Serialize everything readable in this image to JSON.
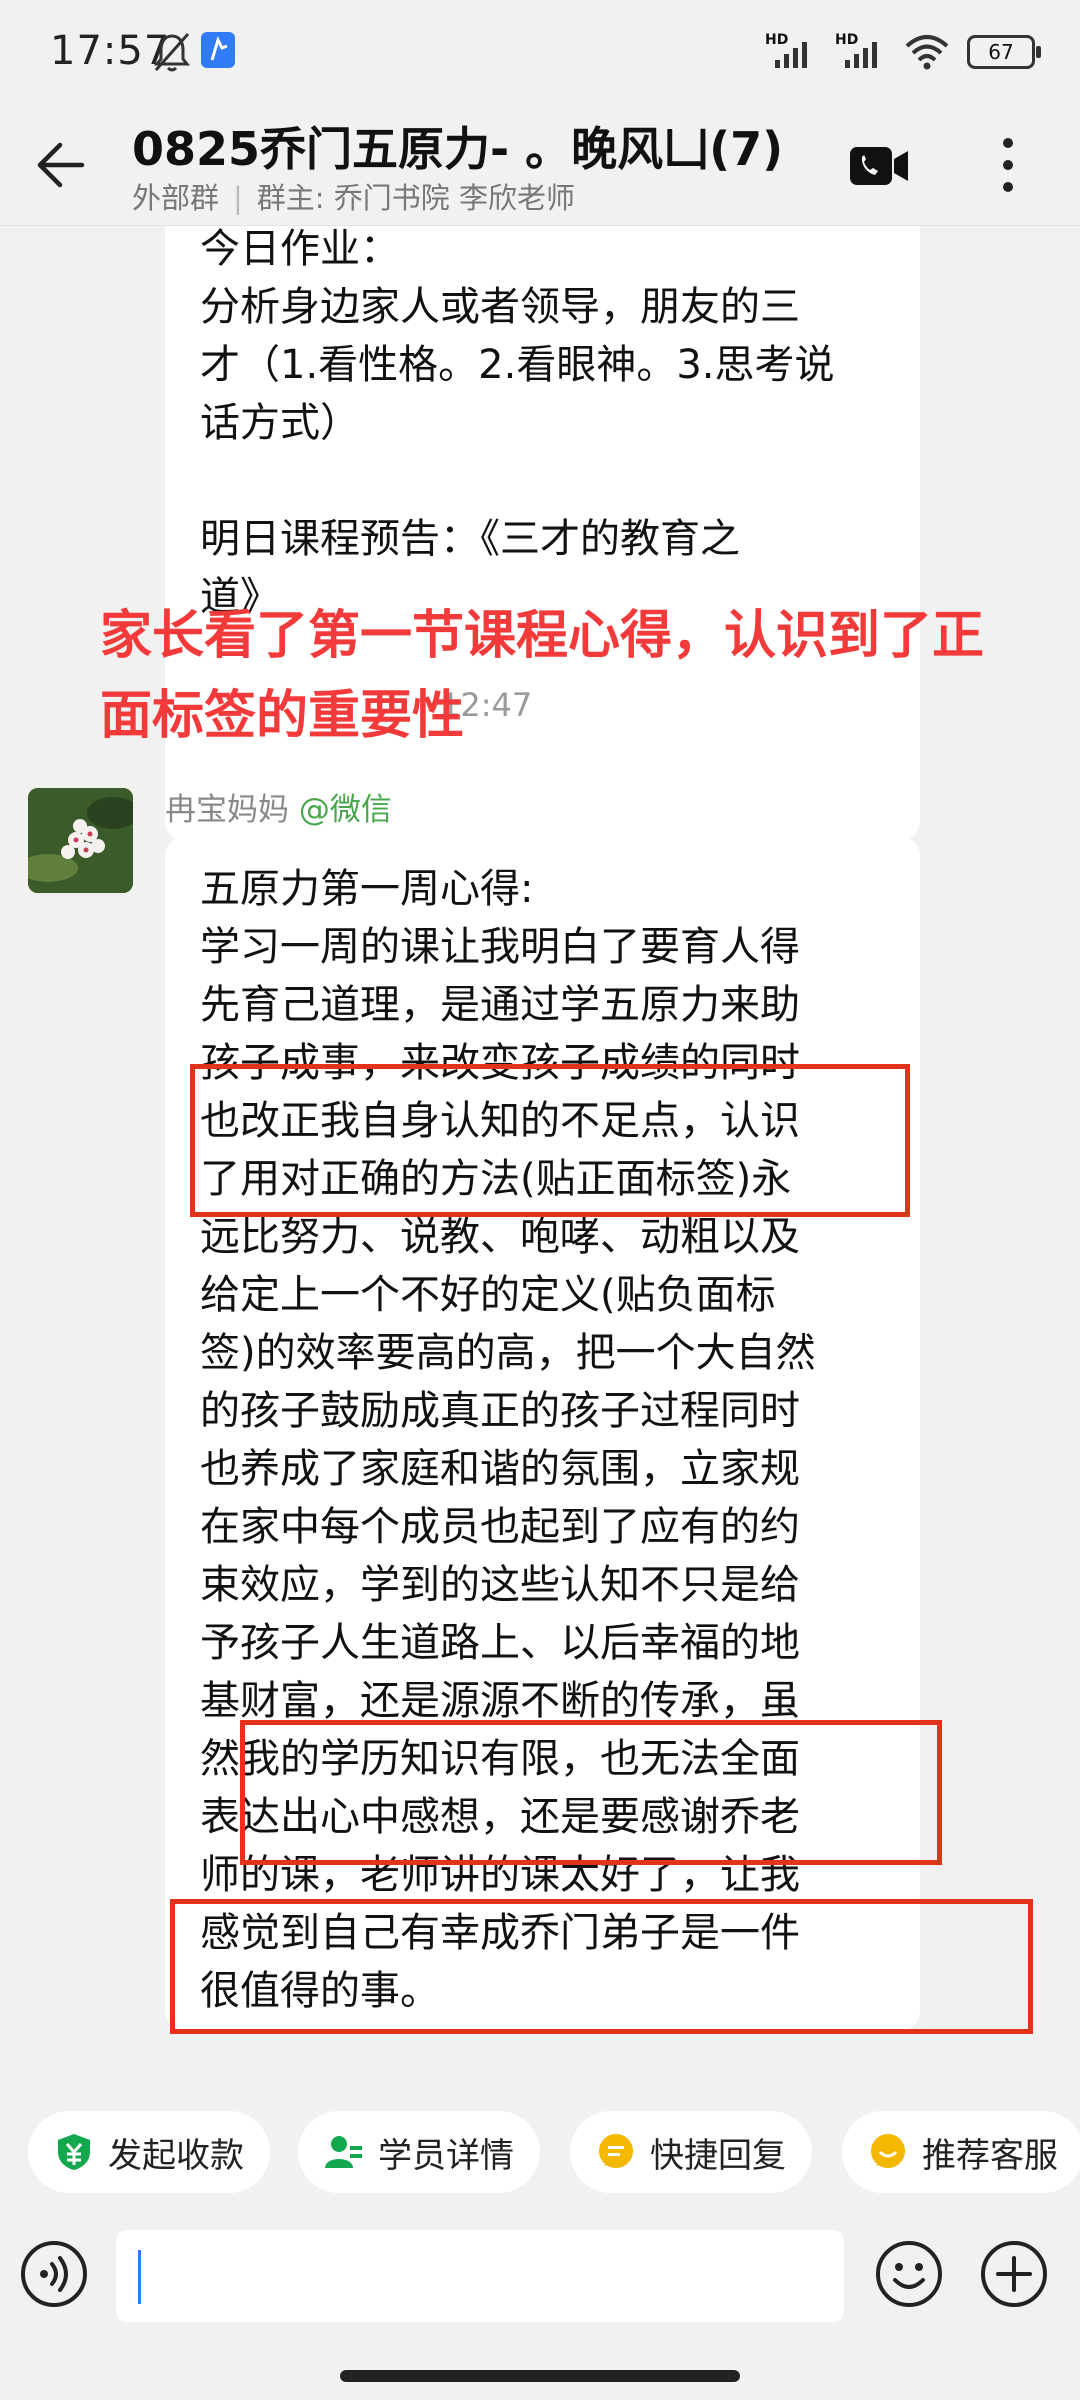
{
  "status_bar": {
    "time": "17:57",
    "icons": [
      "bell-off-icon",
      "app-notification-icon"
    ],
    "signal_labels": [
      "HD",
      "HD"
    ],
    "battery": "67"
  },
  "header": {
    "title": "0825乔门五原力- 。晚风凵(7)",
    "group_type": "外部群",
    "owner": "群主: 乔门书院 李欣老师"
  },
  "messages": {
    "top_bubble_text": "今日作业：\n分析身边家人或者领导，朋友的三\n才（1.看性格。2.看眼神。3.思考说\n话方式）\n\n明日课程预告：《三才的教育之\n道》",
    "overlay_annotation": "家长看了第一节课程心得，认识到了正面标签的重要性",
    "timestamp": "12:47",
    "sender_name": "冉宝妈妈",
    "sender_source": "@微信",
    "main_bubble_text": "五原力第一周心得:\n学习一周的课让我明白了要育人得\n先育己道理，是通过学五原力来助\n孩子成事，来改变孩子成绩的同时\n也改正我自身认知的不足点，认识\n了用对正确的方法(贴正面标签)永\n远比努力、说教、咆哮、动粗以及\n给定上一个不好的定义(贴负面标\n签)的效率要高的高，把一个大自然\n的孩子鼓励成真正的孩子过程同时\n也养成了家庭和谐的氛围，立家规\n在家中每个成员也起到了应有的约\n束效应，学到的这些认知不只是给\n予孩子人生道路上、以后幸福的地\n基财富，还是源源不断的传承，虽\n然我的学历知识有限，也无法全面\n表达出心中感想，还是要感谢乔老\n师的课，老师讲的课太好了，让我\n感觉到自己有幸成乔门弟子是一件\n很值得的事。"
  },
  "quick_actions": [
    {
      "label": "发起收款",
      "icon": "payment-shield-icon",
      "color": "#13a84e"
    },
    {
      "label": "学员详情",
      "icon": "user-card-icon",
      "color": "#13a84e"
    },
    {
      "label": "快捷回复",
      "icon": "quick-reply-icon",
      "color": "#f5b800"
    },
    {
      "label": "推荐客服",
      "icon": "service-smile-icon",
      "color": "#f5b800"
    }
  ],
  "input": {
    "placeholder": ""
  },
  "colors": {
    "annotation_red": "#f23a3a",
    "highlight_box": "#e3331b",
    "wechat_green": "#4aa64c"
  }
}
